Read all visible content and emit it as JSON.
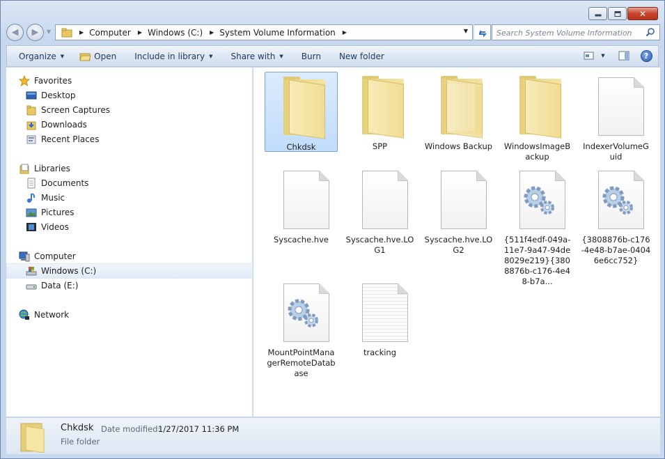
{
  "window": {
    "caption_buttons": {
      "minimize": "",
      "maximize": "",
      "close": "✕"
    }
  },
  "address": {
    "crumbs": [
      "Computer",
      "Windows (C:)",
      "System Volume Information"
    ]
  },
  "search": {
    "placeholder": "Search System Volume Information"
  },
  "toolbar": {
    "organize": "Organize",
    "open": "Open",
    "include_in_library": "Include in library",
    "share_with": "Share with",
    "burn": "Burn",
    "new_folder": "New folder",
    "help": "?"
  },
  "sidebar": {
    "favorites": "Favorites",
    "desktop": "Desktop",
    "screen_captures": "Screen Captures",
    "downloads": "Downloads",
    "recent_places": "Recent Places",
    "libraries": "Libraries",
    "documents": "Documents",
    "music": "Music",
    "pictures": "Pictures",
    "videos": "Videos",
    "computer": "Computer",
    "windows_c": "Windows (C:)",
    "data_e": "Data (E:)",
    "network": "Network"
  },
  "files": [
    {
      "name": "Chkdsk",
      "icon": "folder-icon"
    },
    {
      "name": "SPP",
      "icon": "folder-icon"
    },
    {
      "name": "Windows Backup",
      "icon": "folder-with-pages-icon"
    },
    {
      "name": "WindowsImageBackup",
      "icon": "folder-icon"
    },
    {
      "name": "IndexerVolumeGuid",
      "icon": "document-icon"
    },
    {
      "name": "Syscache.hve",
      "icon": "document-icon"
    },
    {
      "name": "Syscache.hve.LOG1",
      "icon": "document-icon"
    },
    {
      "name": "Syscache.hve.LOG2",
      "icon": "document-icon"
    },
    {
      "name": "{511f4edf-049a-11e7-9a47-94de8029e219}{3808876b-c176-4e48-b7a...",
      "icon": "system-file-icon"
    },
    {
      "name": "{3808876b-c176-4e48-b7ae-04046e6cc752}",
      "icon": "system-file-icon"
    },
    {
      "name": "MountPointManagerRemoteDatabase",
      "icon": "system-file-icon"
    },
    {
      "name": "tracking",
      "icon": "text-document-icon"
    }
  ],
  "details": {
    "name": "Chkdsk",
    "date_label": "Date modified:",
    "date_value": "1/27/2017 11:36 PM",
    "type": "File folder"
  },
  "colors": {
    "selection": "#c1dcfb",
    "toolbar_text": "#1e395b"
  }
}
